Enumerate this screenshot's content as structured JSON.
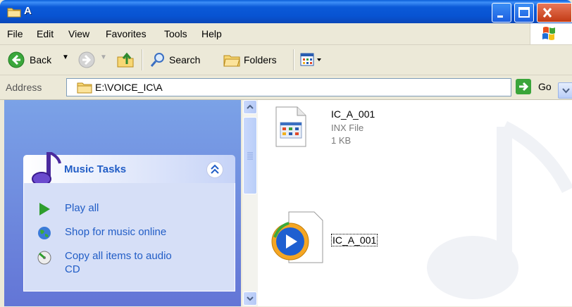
{
  "window": {
    "title": "A"
  },
  "menu": {
    "items": [
      "File",
      "Edit",
      "View",
      "Favorites",
      "Tools",
      "Help"
    ]
  },
  "toolbar": {
    "back_label": "Back",
    "search_label": "Search",
    "folders_label": "Folders"
  },
  "address": {
    "label": "Address",
    "path": "E:\\VOICE_IC\\A",
    "go_label": "Go"
  },
  "tasks_panel": {
    "title": "Music Tasks",
    "items": [
      {
        "label": "Play all",
        "icon": "play-icon"
      },
      {
        "label": "Shop for music online",
        "icon": "globe-icon"
      },
      {
        "label": "Copy all items to audio",
        "label2": "CD",
        "icon": "cd-copy-icon"
      }
    ]
  },
  "files": [
    {
      "name": "IC_A_001",
      "type": "INX File",
      "size": "1 KB",
      "icon": "inx-file-icon"
    },
    {
      "name": "IC_A_001",
      "icon": "windows-media-player-icon",
      "selected": true
    }
  ],
  "colors": {
    "title_bar": "#0A5FD8",
    "task_pane": "#7BA2E7",
    "task_link": "#215DC6"
  }
}
